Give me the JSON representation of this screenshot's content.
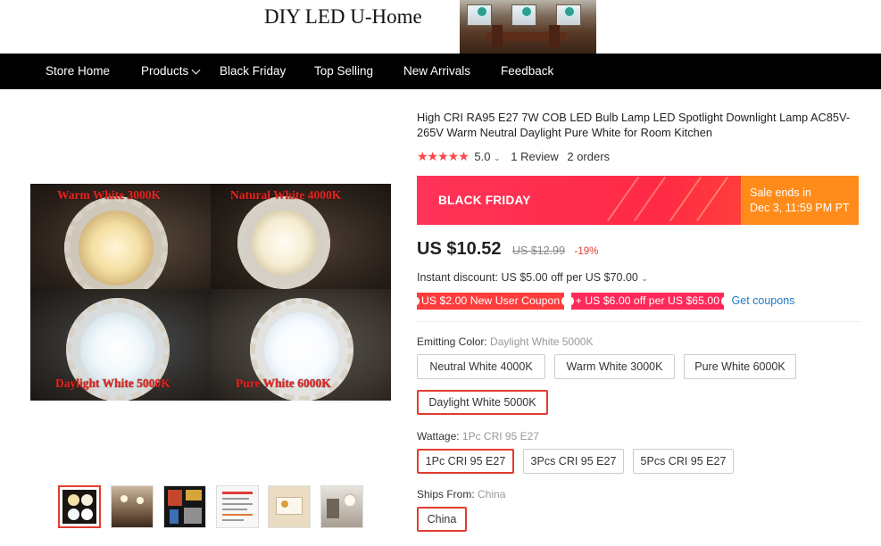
{
  "store": {
    "brand": "DIY LED U-Home"
  },
  "nav": {
    "items": [
      "Store Home",
      "Products",
      "Black Friday",
      "Top Selling",
      "New Arrivals",
      "Feedback"
    ]
  },
  "gallery": {
    "labels": [
      "Warm White 3000K",
      "Natural White 4000K",
      "Daylight White 5000K",
      "Pure White 6000K"
    ],
    "thumbnail_count": 6,
    "active_thumbnail": 1
  },
  "product": {
    "title": "High CRI RA95 E27 7W COB LED Bulb Lamp LED Spotlight Downlight Lamp AC85V-265V Warm Neutral Daylight Pure White for Room Kitchen",
    "rating": "5.0",
    "reviews": "1 Review",
    "orders": "2 orders",
    "stars": 5
  },
  "promo": {
    "label": "BLACK FRIDAY",
    "sale_line1": "Sale ends in",
    "sale_line2": "Dec 3, 11:59 PM PT"
  },
  "price": {
    "current": "US $10.52",
    "original": "US $12.99",
    "discount": "-19%"
  },
  "instant_discount": "Instant discount: US $5.00 off per US $70.00",
  "coupons": {
    "new_user": "US $2.00 New User Coupon",
    "store": "+ US $6.00 off per US $65.00",
    "get_coupons": "Get coupons"
  },
  "emitting_color": {
    "label": "Emitting Color:",
    "selected": "Daylight White 5000K",
    "options": [
      "Neutral White 4000K",
      "Warm White 3000K",
      "Pure White 6000K",
      "Daylight White 5000K"
    ]
  },
  "wattage": {
    "label": "Wattage:",
    "selected": "1Pc CRI 95 E27",
    "options": [
      "1Pc CRI 95 E27",
      "3Pcs CRI 95 E27",
      "5Pcs CRI 95 E27"
    ]
  },
  "ships_from": {
    "label": "Ships From:",
    "selected": "China",
    "options": [
      "China"
    ]
  },
  "colors": {
    "accent": "#e13c2f",
    "nav_bg": "#000000",
    "promo_bg": "#ff3358",
    "sale_bg": "#ff8c1a",
    "link": "#1d7ac9"
  }
}
